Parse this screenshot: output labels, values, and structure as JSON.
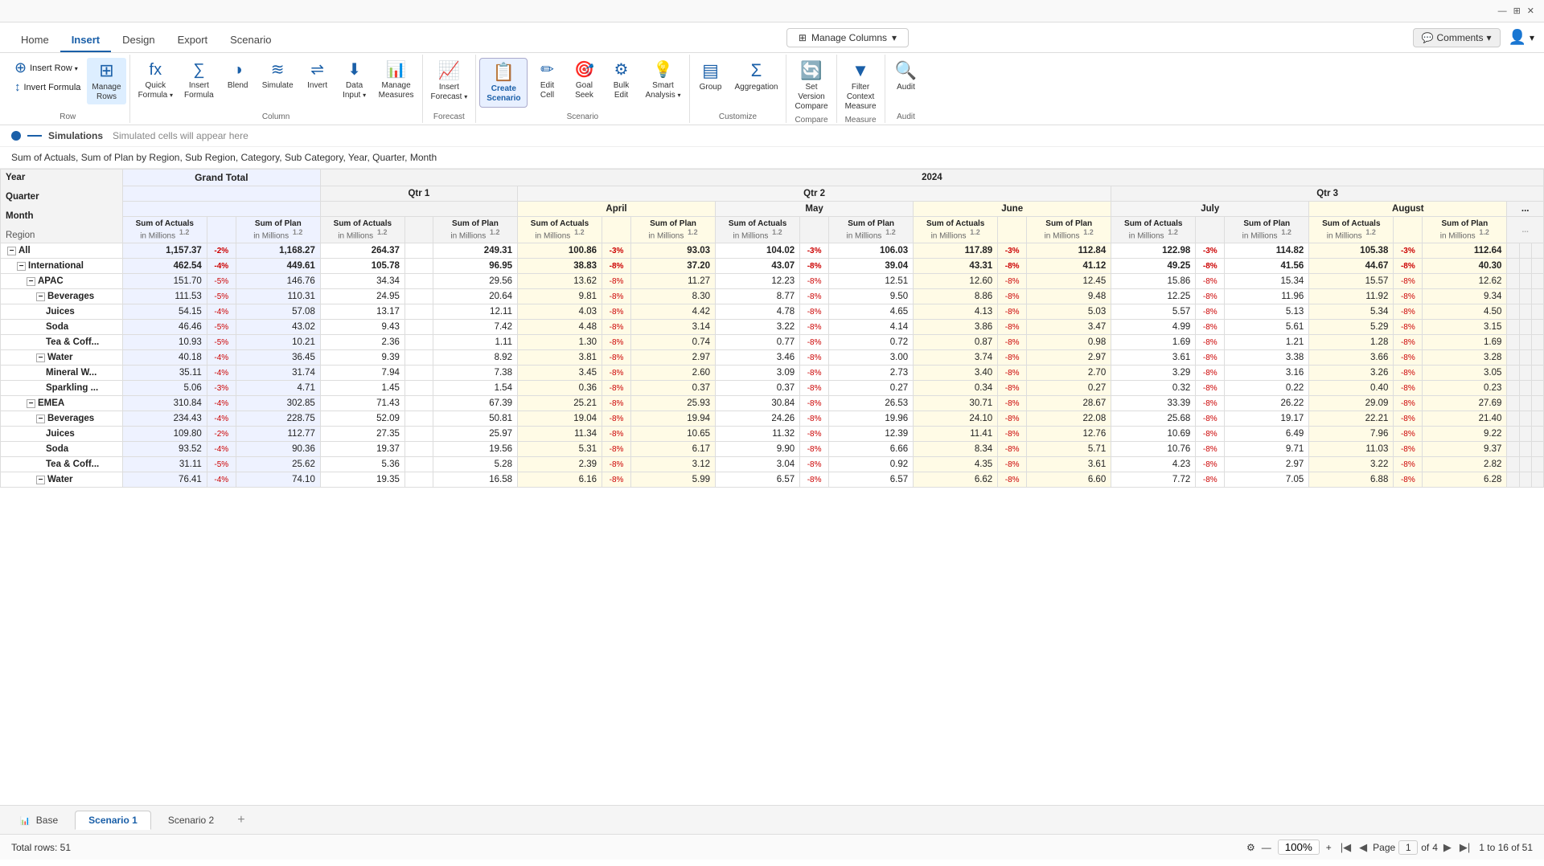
{
  "topbar": {
    "right_items": [
      "⊞",
      "—",
      "✕"
    ]
  },
  "nav": {
    "tabs": [
      "Home",
      "Insert",
      "Design",
      "Export",
      "Scenario"
    ],
    "active_tab": "Insert",
    "manage_columns_label": "Manage Columns",
    "comments_label": "Comments"
  },
  "ribbon": {
    "groups": [
      {
        "label": "Row",
        "items": [
          {
            "id": "insert-row",
            "icon": "➕",
            "label": "Insert\nRow",
            "has_arrow": true
          },
          {
            "id": "invert-formula",
            "icon": "↕",
            "label": "Invert\nFormula"
          },
          {
            "id": "manage-rows",
            "icon": "⊞",
            "label": "Manage\nRows",
            "active": true
          }
        ]
      },
      {
        "label": "Column",
        "items": [
          {
            "id": "quick-formula",
            "icon": "fx",
            "label": "Quick\nFormula",
            "has_arrow": true
          },
          {
            "id": "insert-formula",
            "icon": "∑",
            "label": "Insert\nFormula"
          },
          {
            "id": "blend",
            "icon": "⬛",
            "label": "Blend"
          },
          {
            "id": "simulate",
            "icon": "◐",
            "label": "Simulate"
          },
          {
            "id": "invert",
            "icon": "↔",
            "label": "Invert"
          },
          {
            "id": "data-input",
            "icon": "⬇",
            "label": "Data\nInput",
            "has_arrow": true
          },
          {
            "id": "manage-measures",
            "icon": "📊",
            "label": "Manage\nMeasures"
          }
        ]
      },
      {
        "label": "Forecast",
        "items": [
          {
            "id": "insert-forecast",
            "icon": "📈",
            "label": "Insert\nForecast",
            "has_arrow": true
          }
        ]
      },
      {
        "label": "Scenario",
        "items": [
          {
            "id": "create-scenario",
            "icon": "📋",
            "label": "Create\nScenario",
            "bold": true
          },
          {
            "id": "edit-cell",
            "icon": "✏",
            "label": "Edit\nCell"
          },
          {
            "id": "goal-seek",
            "icon": "🎯",
            "label": "Goal\nSeek"
          },
          {
            "id": "bulk-edit",
            "icon": "⚙",
            "label": "Bulk\nEdit"
          },
          {
            "id": "smart-analysis",
            "icon": "💡",
            "label": "Smart\nAnalysis",
            "has_arrow": true
          }
        ]
      },
      {
        "label": "Customize",
        "items": [
          {
            "id": "group",
            "icon": "▤",
            "label": "Group"
          },
          {
            "id": "aggregation",
            "icon": "Σ",
            "label": "Aggregation"
          }
        ]
      },
      {
        "label": "Compare",
        "items": [
          {
            "id": "set-version",
            "icon": "🔄",
            "label": "Set\nVersion\nCompare"
          }
        ]
      },
      {
        "label": "Measure",
        "items": [
          {
            "id": "filter-context",
            "icon": "▼",
            "label": "Filter\nContext\nMeasure"
          }
        ]
      },
      {
        "label": "Audit",
        "items": [
          {
            "id": "audit",
            "icon": "🔍",
            "label": "Audit"
          }
        ]
      }
    ]
  },
  "sim_bar": {
    "label": "Simulations",
    "hint": "Simulated cells will appear here"
  },
  "description": "Sum of Actuals, Sum of Plan by Region, Sub Region, Category, Sub Category, Year, Quarter, Month",
  "table": {
    "row_headers": [
      "Year",
      "Quarter",
      "Month",
      "Region"
    ],
    "col_groups": [
      {
        "label": "Grand Total",
        "span": 3,
        "cols": [
          {
            "label": "Sum of Actuals in Millions",
            "sub": "1.2"
          },
          {
            "label": "",
            "sub": ""
          },
          {
            "label": "Sum of Plan in Millions",
            "sub": "1.2"
          }
        ]
      },
      {
        "label": "2024",
        "span": 30,
        "quarters": [
          {
            "label": "Qtr 1",
            "span": 8,
            "months": [],
            "cols": [
              {
                "label": "Sum of Actuals in Millions",
                "sub": "1.2"
              },
              {
                "label": "",
                "sub": ""
              },
              {
                "label": "Sum of Plan in Millions",
                "sub": "1.2"
              }
            ]
          },
          {
            "label": "Qtr 2",
            "span": 12,
            "months": [
              {
                "label": "April",
                "cols": [
                  {
                    "label": "Sum of Actuals in Millions",
                    "sub": "1.2"
                  },
                  {
                    "label": "",
                    "sub": ""
                  },
                  {
                    "label": "Sum of Plan in Millions",
                    "sub": "1.2"
                  }
                ]
              },
              {
                "label": "May",
                "cols": [
                  {
                    "label": "Sum of Actuals in Millions",
                    "sub": "1.2"
                  },
                  {
                    "label": "",
                    "sub": ""
                  },
                  {
                    "label": "Sum of Plan in Millions",
                    "sub": "1.2"
                  }
                ]
              },
              {
                "label": "June",
                "cols": [
                  {
                    "label": "Sum of Actuals in Millions",
                    "sub": "1.2"
                  },
                  {
                    "label": "",
                    "sub": ""
                  },
                  {
                    "label": "Sum of Plan in Millions",
                    "sub": "1.2"
                  }
                ]
              }
            ]
          },
          {
            "label": "Qtr 3",
            "span": 12,
            "months": [
              {
                "label": "July",
                "cols": [
                  {
                    "label": "Sum of Actuals in Millions",
                    "sub": "1.2"
                  },
                  {
                    "label": "",
                    "sub": ""
                  },
                  {
                    "label": "Sum of Plan in Millions",
                    "sub": "1.2"
                  }
                ]
              },
              {
                "label": "August",
                "cols": [
                  {
                    "label": "Sum of Actuals in Millions",
                    "sub": "1.2"
                  },
                  {
                    "label": "",
                    "sub": ""
                  },
                  {
                    "label": "Sum of Plan in Millions",
                    "sub": "1.2"
                  }
                ]
              }
            ]
          }
        ]
      }
    ],
    "rows": [
      {
        "label": "All",
        "indent": 0,
        "expand": "minus",
        "bold": true,
        "vals": [
          "1,157.37",
          "-2%",
          "1,168.27",
          "264.37",
          "249.31",
          "100.86",
          "-3%",
          "93.03",
          "104.02",
          "-3%",
          "106.03",
          "117.89",
          "-3%",
          "112.84",
          "122.98",
          "-3%",
          "114.82",
          "105.38",
          "-3%",
          "112.64"
        ]
      },
      {
        "label": "International",
        "indent": 1,
        "expand": "minus",
        "bold": true,
        "vals": [
          "462.54",
          "-4%",
          "449.61",
          "105.78",
          "96.95",
          "38.83",
          "-8%",
          "37.20",
          "43.07",
          "-8%",
          "39.04",
          "43.31",
          "-8%",
          "41.12",
          "49.25",
          "-8%",
          "41.56",
          "44.67",
          "-8%",
          "40.30"
        ]
      },
      {
        "label": "APAC",
        "indent": 2,
        "expand": "minus",
        "bold": false,
        "vals": [
          "151.70",
          "-5%",
          "146.76",
          "34.34",
          "29.56",
          "13.62",
          "-8%",
          "11.27",
          "12.23",
          "-8%",
          "12.51",
          "12.60",
          "-8%",
          "12.45",
          "15.86",
          "-8%",
          "15.34",
          "15.57",
          "-8%",
          "12.62"
        ]
      },
      {
        "label": "Beverages",
        "indent": 3,
        "expand": "minus",
        "bold": false,
        "vals": [
          "111.53",
          "-5%",
          "110.31",
          "24.95",
          "20.64",
          "9.81",
          "-8%",
          "8.30",
          "8.77",
          "-8%",
          "9.50",
          "8.86",
          "-8%",
          "9.48",
          "12.25",
          "-8%",
          "11.96",
          "11.92",
          "-8%",
          "9.34"
        ]
      },
      {
        "label": "Juices",
        "indent": 4,
        "expand": "",
        "bold": false,
        "vals": [
          "54.15",
          "-4%",
          "57.08",
          "13.17",
          "12.11",
          "4.03",
          "-8%",
          "4.42",
          "4.78",
          "-8%",
          "4.65",
          "4.13",
          "-8%",
          "5.03",
          "5.57",
          "-8%",
          "5.13",
          "5.34",
          "-8%",
          "4.50"
        ]
      },
      {
        "label": "Soda",
        "indent": 4,
        "expand": "",
        "bold": false,
        "vals": [
          "46.46",
          "-5%",
          "43.02",
          "9.43",
          "7.42",
          "4.48",
          "-8%",
          "3.14",
          "3.22",
          "-8%",
          "4.14",
          "3.86",
          "-8%",
          "3.47",
          "4.99",
          "-8%",
          "5.61",
          "5.29",
          "-8%",
          "3.15"
        ]
      },
      {
        "label": "Tea & Coff...",
        "indent": 4,
        "expand": "",
        "bold": false,
        "vals": [
          "10.93",
          "-5%",
          "10.21",
          "2.36",
          "1.11",
          "1.30",
          "-8%",
          "0.74",
          "0.77",
          "-8%",
          "0.72",
          "0.87",
          "-8%",
          "0.98",
          "1.69",
          "-8%",
          "1.21",
          "1.28",
          "-8%",
          "1.69"
        ]
      },
      {
        "label": "Water",
        "indent": 3,
        "expand": "minus",
        "bold": false,
        "vals": [
          "40.18",
          "-4%",
          "36.45",
          "9.39",
          "8.92",
          "3.81",
          "-8%",
          "2.97",
          "3.46",
          "-8%",
          "3.00",
          "3.74",
          "-8%",
          "2.97",
          "3.61",
          "-8%",
          "3.38",
          "3.66",
          "-8%",
          "3.28"
        ]
      },
      {
        "label": "Mineral W...",
        "indent": 4,
        "expand": "",
        "bold": false,
        "vals": [
          "35.11",
          "-4%",
          "31.74",
          "7.94",
          "7.38",
          "3.45",
          "-8%",
          "2.60",
          "3.09",
          "-8%",
          "2.73",
          "3.40",
          "-8%",
          "2.70",
          "3.29",
          "-8%",
          "3.16",
          "3.26",
          "-8%",
          "3.05"
        ]
      },
      {
        "label": "Sparkling ...",
        "indent": 4,
        "expand": "",
        "bold": false,
        "vals": [
          "5.06",
          "-3%",
          "4.71",
          "1.45",
          "1.54",
          "0.36",
          "-8%",
          "0.37",
          "0.37",
          "-8%",
          "0.27",
          "0.34",
          "-8%",
          "0.27",
          "0.32",
          "-8%",
          "0.22",
          "0.40",
          "-8%",
          "0.23"
        ]
      },
      {
        "label": "EMEA",
        "indent": 2,
        "expand": "minus",
        "bold": false,
        "vals": [
          "310.84",
          "-4%",
          "302.85",
          "71.43",
          "67.39",
          "25.21",
          "-8%",
          "25.93",
          "30.84",
          "-8%",
          "26.53",
          "30.71",
          "-8%",
          "28.67",
          "33.39",
          "-8%",
          "26.22",
          "29.09",
          "-8%",
          "27.69"
        ]
      },
      {
        "label": "Beverages",
        "indent": 3,
        "expand": "minus",
        "bold": false,
        "vals": [
          "234.43",
          "-4%",
          "228.75",
          "52.09",
          "50.81",
          "19.04",
          "-8%",
          "19.94",
          "24.26",
          "-8%",
          "19.96",
          "24.10",
          "-8%",
          "22.08",
          "25.68",
          "-8%",
          "19.17",
          "22.21",
          "-8%",
          "21.40"
        ]
      },
      {
        "label": "Juices",
        "indent": 4,
        "expand": "",
        "bold": false,
        "vals": [
          "109.80",
          "-2%",
          "112.77",
          "27.35",
          "25.97",
          "11.34",
          "-8%",
          "10.65",
          "11.32",
          "-8%",
          "12.39",
          "11.41",
          "-8%",
          "12.76",
          "10.69",
          "-8%",
          "6.49",
          "7.96",
          "-8%",
          "9.22"
        ]
      },
      {
        "label": "Soda",
        "indent": 4,
        "expand": "",
        "bold": false,
        "vals": [
          "93.52",
          "-4%",
          "90.36",
          "19.37",
          "19.56",
          "5.31",
          "-8%",
          "6.17",
          "9.90",
          "-8%",
          "6.66",
          "8.34",
          "-8%",
          "5.71",
          "10.76",
          "-8%",
          "9.71",
          "11.03",
          "-8%",
          "9.37"
        ]
      },
      {
        "label": "Tea & Coff...",
        "indent": 4,
        "expand": "",
        "bold": false,
        "vals": [
          "31.11",
          "-5%",
          "25.62",
          "5.36",
          "5.28",
          "2.39",
          "-8%",
          "3.12",
          "3.04",
          "-8%",
          "0.92",
          "4.35",
          "-8%",
          "3.61",
          "4.23",
          "-8%",
          "2.97",
          "3.22",
          "-8%",
          "2.82"
        ]
      },
      {
        "label": "Water",
        "indent": 3,
        "expand": "minus",
        "bold": false,
        "vals": [
          "76.41",
          "-4%",
          "74.10",
          "19.35",
          "16.58",
          "6.16",
          "-8%",
          "5.99",
          "6.57",
          "-8%",
          "6.57",
          "6.62",
          "-8%",
          "6.60",
          "7.72",
          "-8%",
          "7.05",
          "6.88",
          "-8%",
          "6.28"
        ]
      }
    ]
  },
  "tabs": [
    "Base",
    "Scenario 1",
    "Scenario 2"
  ],
  "active_tab": "Scenario 1",
  "status": {
    "total_rows": "Total rows: 51",
    "zoom": "100%",
    "page_label": "Page",
    "page_current": "1",
    "page_total": "4",
    "page_range": "1 to 16 of 51"
  }
}
